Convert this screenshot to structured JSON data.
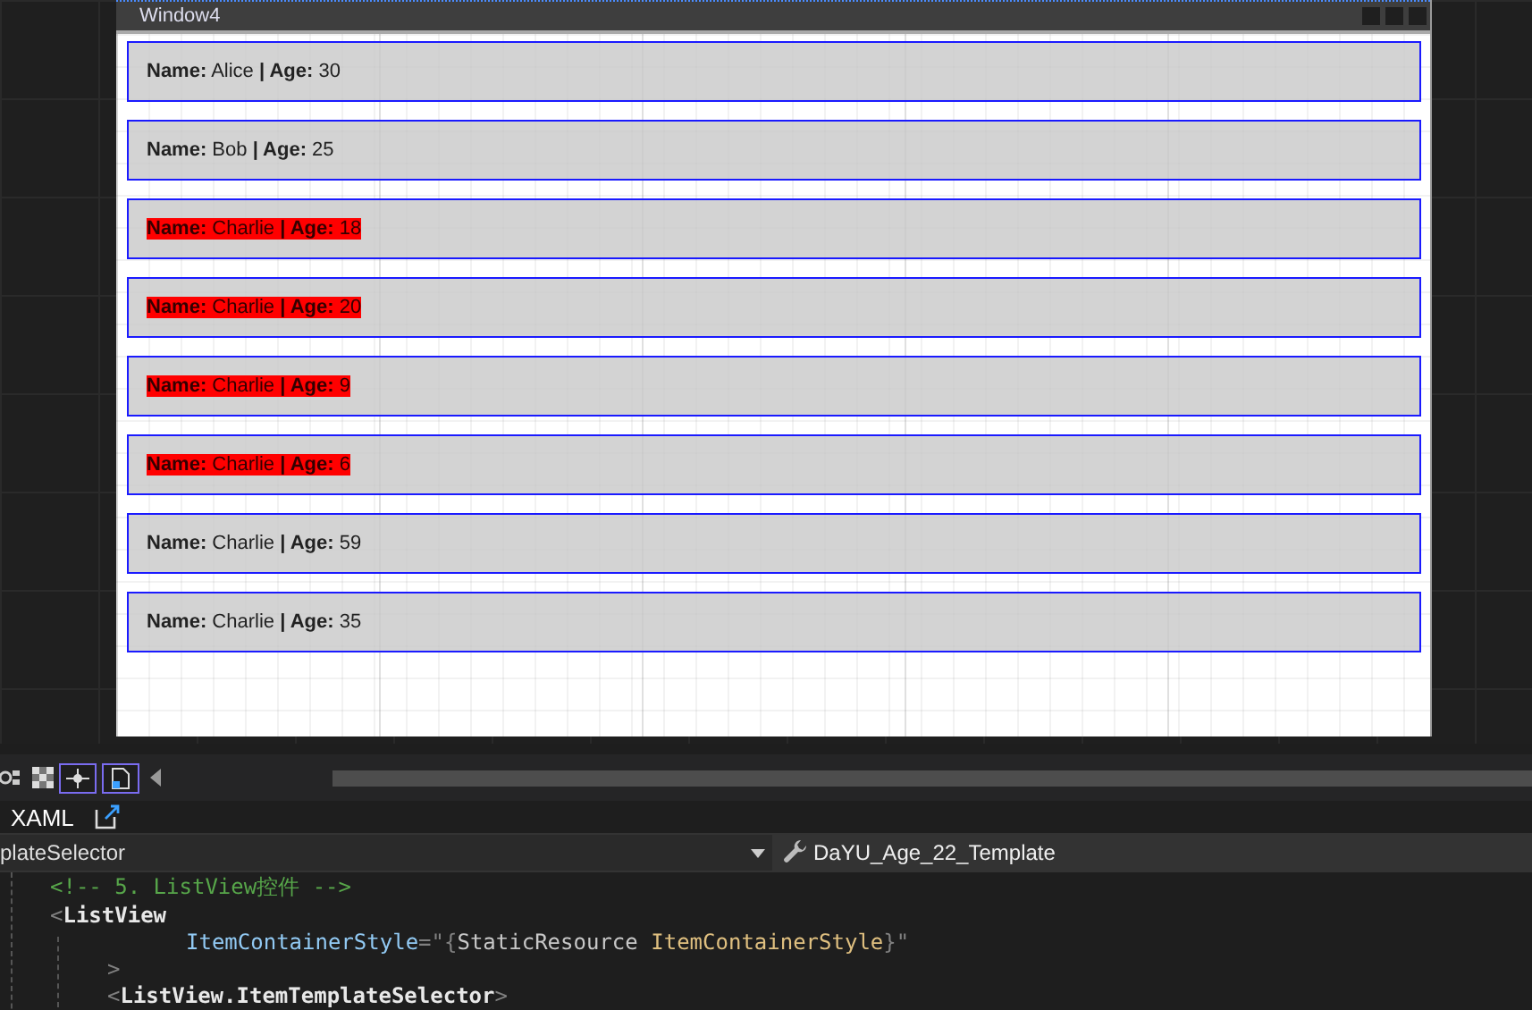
{
  "window": {
    "title": "Window4"
  },
  "list_items": [
    {
      "label": "**Name:** Alice **| Age:** 30",
      "highlighted": false
    },
    {
      "label": "**Name:** Bob **| Age:** 25",
      "highlighted": false
    },
    {
      "label": "**Name:** Charlie **| Age:** 18",
      "highlighted": true
    },
    {
      "label": "**Name:** Charlie **| Age:** 20",
      "highlighted": true
    },
    {
      "label": "**Name:** Charlie **| Age:** 9",
      "highlighted": true
    },
    {
      "label": "**Name:** Charlie **| Age:** 6",
      "highlighted": true
    },
    {
      "label": "**Name:** Charlie **| Age:** 59",
      "highlighted": false
    },
    {
      "label": "**Name:** Charlie **| Age:** 35",
      "highlighted": false
    }
  ],
  "editor_tabs": [
    {
      "label": "XAML",
      "selected": true
    }
  ],
  "navigation": {
    "left": "plateSelector",
    "right": "DaYU_Age_22_Template"
  },
  "code_lines": [
    {
      "kind": "comment",
      "tokens": [
        {
          "kind": "comment",
          "text": "<!-- 5. ListView控件 -->"
        }
      ]
    },
    {
      "kind": "open",
      "tokens": [
        {
          "kind": "punct",
          "text": "<"
        },
        {
          "kind": "tag",
          "text": "ListView"
        }
      ]
    },
    {
      "kind": "attribute",
      "tokens": [
        {
          "kind": "attr",
          "text": "ItemContainerStyle"
        },
        {
          "kind": "punct",
          "text": "=\"{"
        },
        {
          "kind": "ext",
          "text": "StaticResource"
        },
        {
          "kind": "value",
          "text": " ItemContainerStyle"
        },
        {
          "kind": "punct",
          "text": "}\""
        }
      ]
    },
    {
      "kind": "close",
      "tokens": [
        {
          "kind": "punct",
          "text": ">"
        }
      ]
    },
    {
      "kind": "element",
      "tokens": [
        {
          "kind": "punct",
          "text": "<"
        },
        {
          "kind": "tag",
          "text": "ListView.ItemTemplateSelector"
        },
        {
          "kind": "punct",
          "text": ">"
        }
      ]
    }
  ]
}
